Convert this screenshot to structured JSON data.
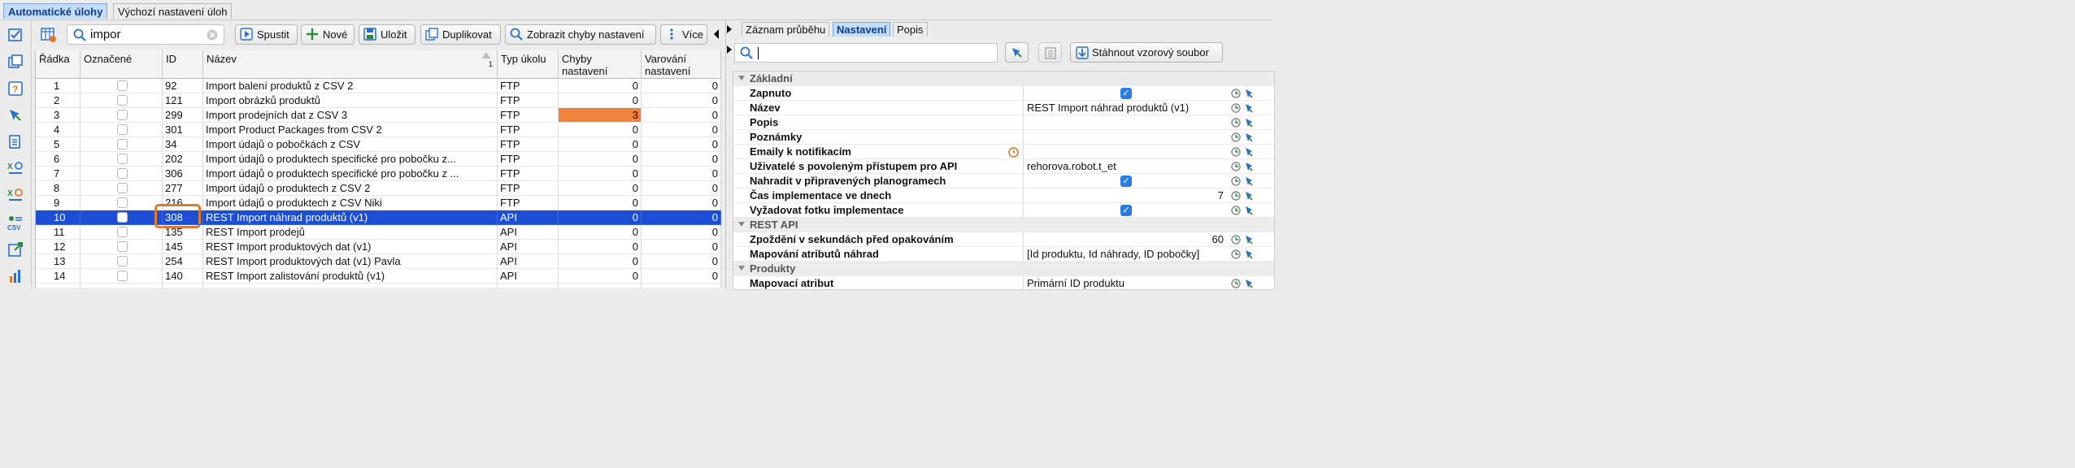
{
  "top_tabs": [
    "Automatické úlohy",
    "Výchozí nastavení úloh"
  ],
  "toolbar": {
    "search_value": "impor",
    "run": "Spustit",
    "new": "Nové",
    "save": "Uložit",
    "duplicate": "Duplikovat",
    "show_errors": "Zobrazit chyby nastavení",
    "more": "Více"
  },
  "grid": {
    "headers": {
      "row": "Řádka",
      "marked": "Označené",
      "id": "ID",
      "name": "Název",
      "sort_index": "1",
      "type": "Typ úkolu",
      "errors": "Chyby nastavení",
      "warnings": "Varování nastavení"
    },
    "rows": [
      {
        "row": "1",
        "id": "92",
        "name": "Import balení produktů z CSV 2",
        "type": "FTP",
        "errors": "0",
        "warnings": "0"
      },
      {
        "row": "2",
        "id": "121",
        "name": "Import obrázků produktů",
        "type": "FTP",
        "errors": "0",
        "warnings": "0"
      },
      {
        "row": "3",
        "id": "299",
        "name": "Import prodejních dat z CSV 3",
        "type": "FTP",
        "errors": "3",
        "warnings": "0"
      },
      {
        "row": "4",
        "id": "301",
        "name": "Import Product Packages from CSV 2",
        "type": "FTP",
        "errors": "0",
        "warnings": "0"
      },
      {
        "row": "5",
        "id": "34",
        "name": "Import údajů o pobočkách z CSV",
        "type": "FTP",
        "errors": "0",
        "warnings": "0"
      },
      {
        "row": "6",
        "id": "202",
        "name": "Import údajů o produktech specifické pro pobočku z...",
        "type": "FTP",
        "errors": "0",
        "warnings": "0"
      },
      {
        "row": "7",
        "id": "306",
        "name": "Import údajů o produktech specifické pro pobočku z ...",
        "type": "FTP",
        "errors": "0",
        "warnings": "0"
      },
      {
        "row": "8",
        "id": "277",
        "name": "Import údajů o produktech z CSV 2",
        "type": "FTP",
        "errors": "0",
        "warnings": "0"
      },
      {
        "row": "9",
        "id": "216",
        "name": "Import údajů o produktech z CSV Niki",
        "type": "FTP",
        "errors": "0",
        "warnings": "0"
      },
      {
        "row": "10",
        "id": "308",
        "name": "REST Import náhrad produktů (v1)",
        "type": "API",
        "errors": "0",
        "warnings": "0"
      },
      {
        "row": "11",
        "id": "135",
        "name": "REST Import prodejů",
        "type": "API",
        "errors": "0",
        "warnings": "0"
      },
      {
        "row": "12",
        "id": "145",
        "name": "REST Import produktových dat (v1)",
        "type": "API",
        "errors": "0",
        "warnings": "0"
      },
      {
        "row": "13",
        "id": "254",
        "name": "REST Import produktových dat (v1) Pavla",
        "type": "API",
        "errors": "0",
        "warnings": "0"
      },
      {
        "row": "14",
        "id": "140",
        "name": "REST Import zalistování produktů (v1)",
        "type": "API",
        "errors": "0",
        "warnings": "0"
      },
      {
        "row": "",
        "id": "",
        "name": "",
        "type": "",
        "errors": "",
        "warnings": ""
      }
    ]
  },
  "right_panel": {
    "tabs": [
      "Záznam průběhu",
      "Nastavení",
      "Popis"
    ],
    "download_button": "Stáhnout vzorový soubor",
    "sections": {
      "basic": "Základní",
      "rest": "REST API",
      "products": "Produkty"
    },
    "props": {
      "enabled": "Zapnuto",
      "name": "Název",
      "name_value": "REST Import náhrad produktů (v1)",
      "description": "Popis",
      "notes": "Poznámky",
      "emails": "Emaily k notifikacím",
      "users": "Uživatelé s povoleným přístupem pro API",
      "users_value": "rehorova.robot.t_et",
      "replace": "Nahradit v připravených planogramech",
      "days": "Čas implementace ve dnech",
      "days_value": "7",
      "photo": "Vyžadovat fotku implementace",
      "delay": "Zpoždění v sekundách před opakováním",
      "delay_value": "60",
      "mapping": "Mapování atributů náhrad",
      "mapping_value": "[Id produktu, Id náhrady, ID pobočky]",
      "map_attr": "Mapovací atribut",
      "map_attr_value": "Primární ID produktu"
    }
  },
  "colors": {
    "selection": "#1d4fd6",
    "error_highlight": "#f0843f",
    "focus_ring": "#e07a2e",
    "active_tab": "#c4dcf6"
  }
}
